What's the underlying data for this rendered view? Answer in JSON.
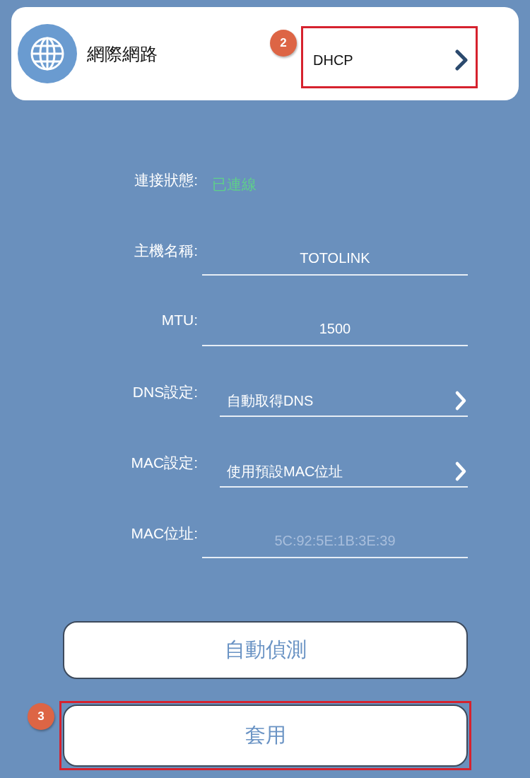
{
  "header": {
    "title": "網際網路",
    "connection_type": "DHCP",
    "highlighted": true,
    "step": "2"
  },
  "fields": [
    {
      "kind": "status",
      "label": "連接狀態:",
      "value": "已連線",
      "color": "#5fcf8a"
    },
    {
      "kind": "input",
      "label": "主機名稱:",
      "value": "TOTOLINK"
    },
    {
      "kind": "input",
      "label": "MTU:",
      "value": "1500"
    },
    {
      "kind": "select",
      "label": "DNS設定:",
      "value": "自動取得DNS"
    },
    {
      "kind": "select",
      "label": "MAC設定:",
      "value": "使用預設MAC位址"
    },
    {
      "kind": "readonly",
      "label": "MAC位址:",
      "value": "5C:92:5E:1B:3E:39"
    }
  ],
  "buttons": [
    {
      "label": "自動偵測",
      "highlighted": false
    },
    {
      "label": "套用",
      "highlighted": true,
      "step": "3"
    }
  ]
}
